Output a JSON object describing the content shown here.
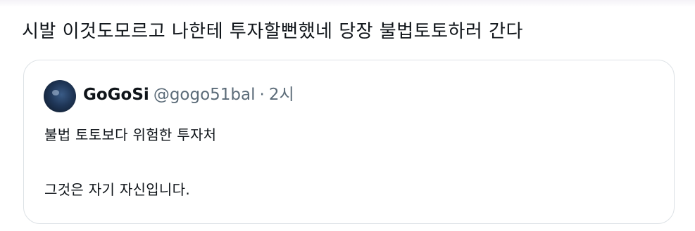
{
  "post": {
    "text": "시발 이것도모르고 나한테 투자할뻔했네 당장 불법토토하러 간다"
  },
  "quoted_post": {
    "author_name": "GoGoSi",
    "author_handle": "@gogo51bal",
    "separator": "·",
    "time": "2시",
    "lines": [
      "불법 토토보다 위험한 투자처",
      "그것은 자기 자신입니다."
    ]
  }
}
